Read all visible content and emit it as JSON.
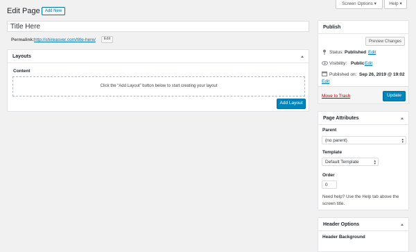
{
  "header": {
    "title": "Edit Page",
    "add_new_label": "Add New",
    "screen_options_label": "Screen Options ▾",
    "help_label": "Help ▾"
  },
  "editor": {
    "title_value": "Title Here",
    "permalink_label": "Permalink:",
    "permalink_url": "http://shireasver.com/title-here/",
    "permalink_edit_label": "Edit"
  },
  "layouts_box": {
    "title": "Layouts",
    "content_label": "Content",
    "empty_message": "Click the “Add Layout” button below to start creating your layout",
    "add_layout_label": "Add Layout"
  },
  "publish": {
    "title": "Publish",
    "preview_label": "Preview Changes",
    "status_label": "Status:",
    "status_value": "Published",
    "status_edit": "Edit",
    "visibility_label": "Visibility:",
    "visibility_value": "Public",
    "visibility_edit": "Edit",
    "published_label": "Published on:",
    "published_value": "Sep 26, 2019 @ 19:02",
    "published_edit": "Edit",
    "trash_label": "Move to Trash",
    "update_label": "Update"
  },
  "page_attributes": {
    "title": "Page Attributes",
    "parent_label": "Parent",
    "parent_value": "(no parent)",
    "template_label": "Template",
    "template_value": "Default Template",
    "order_label": "Order",
    "order_value": "0",
    "help_text_line1": "Need help? Use the Help tab above the",
    "help_text_line2": "screen title."
  },
  "header_options": {
    "title": "Header Options",
    "background_label": "Header Background"
  },
  "icons": {
    "status": "pin-icon",
    "visibility": "eye-icon",
    "published": "calendar-icon"
  },
  "colors": {
    "primary": "#0085ba",
    "link": "#0073aa",
    "trash": "#a00",
    "background": "#f1f1f1"
  }
}
